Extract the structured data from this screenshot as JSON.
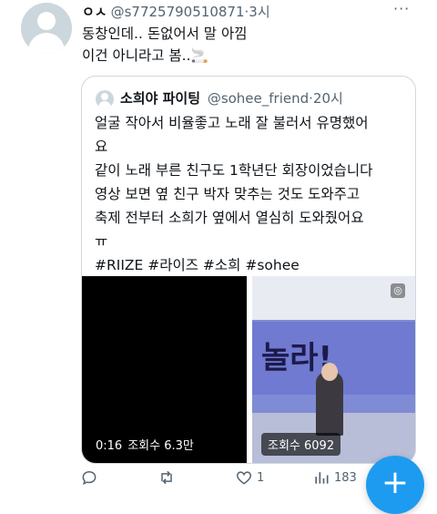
{
  "post": {
    "author_name": "ㅇㅅ",
    "handle": "@s7725790510871",
    "separator": "·",
    "time": "3시",
    "more_label": "···",
    "text_lines": [
      "동창인데.. 돈없어서 말 아낌",
      "이건 아니라고 봄..🚬"
    ]
  },
  "quote": {
    "author_name": "소희야 파이팅",
    "handle": "@sohee_friend",
    "separator": "·",
    "time": "20시",
    "lines": [
      "얼굴 작아서 비율좋고 노래 잘 불러서 유명했어",
      "요",
      "같이 노래 부른 친구도 1학년단 회장이었습니다",
      "영상 보면 옆 친구 박자 맞추는 것도 도와주고",
      "축제 전부터 소희가 옆에서 열심히 도와줬어요",
      "ㅠ"
    ],
    "hashtags": "#RIIZE #라이즈 #소희 #sohee",
    "media": {
      "left": {
        "duration": "0:16",
        "views": "조회수 6.3만"
      },
      "right": {
        "views": "조회수 6092",
        "sign_text": "놀라!"
      }
    }
  },
  "actions": {
    "reply_count": "",
    "retweet_count": "",
    "like_count": "1",
    "views_count": "183"
  },
  "fab": {
    "label": "+"
  },
  "colors": {
    "accent": "#1d9bf0",
    "secondary_text": "#536471",
    "border": "#cfd9de"
  }
}
